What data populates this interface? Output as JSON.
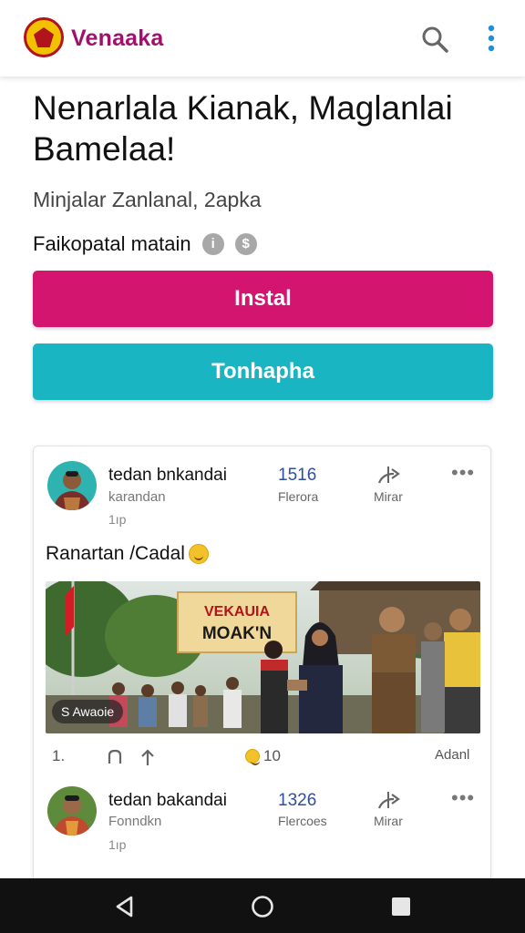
{
  "app": {
    "brand": "Venaaka",
    "colors": {
      "brand": "#a0116e",
      "install": "#d4156f",
      "secondary": "#19b5c3"
    }
  },
  "header": {
    "icons": [
      "logo-emblem",
      "search-icon",
      "more-vert-icon"
    ]
  },
  "article": {
    "headline": "Nenarlala Kianak, Maglanlai Bamelaa!",
    "subtitle": "Minjalar Zanlanal, 2apka",
    "meta": "Faikopatal matain",
    "meta_icons": [
      "info-icon",
      "settings-icon"
    ]
  },
  "buttons": {
    "install": "Instal",
    "secondary": "Tonhapha"
  },
  "feed": {
    "posts": [
      {
        "name": "tedan bnkandai",
        "subtitle": "karandan",
        "time": "1ıp",
        "count": "1516",
        "count_label": "Flerora",
        "action_label": "Mirar",
        "more": "•••",
        "caption": "Ranartan /Cadal",
        "photo_banner": "VEKAUIA MOAK'N",
        "photo_tag": "S Awaoie",
        "actions": {
          "comments": "1.",
          "reactions": "10",
          "add": "Adanl"
        }
      },
      {
        "name": "tedan bakandai",
        "subtitle": "Fonndkn",
        "time": "1ıp",
        "count": "1326",
        "count_label": "Flercoes",
        "action_label": "Mirar",
        "more": "•••"
      }
    ]
  },
  "nav": {
    "icons": [
      "back-icon",
      "home-icon",
      "recents-icon"
    ]
  }
}
